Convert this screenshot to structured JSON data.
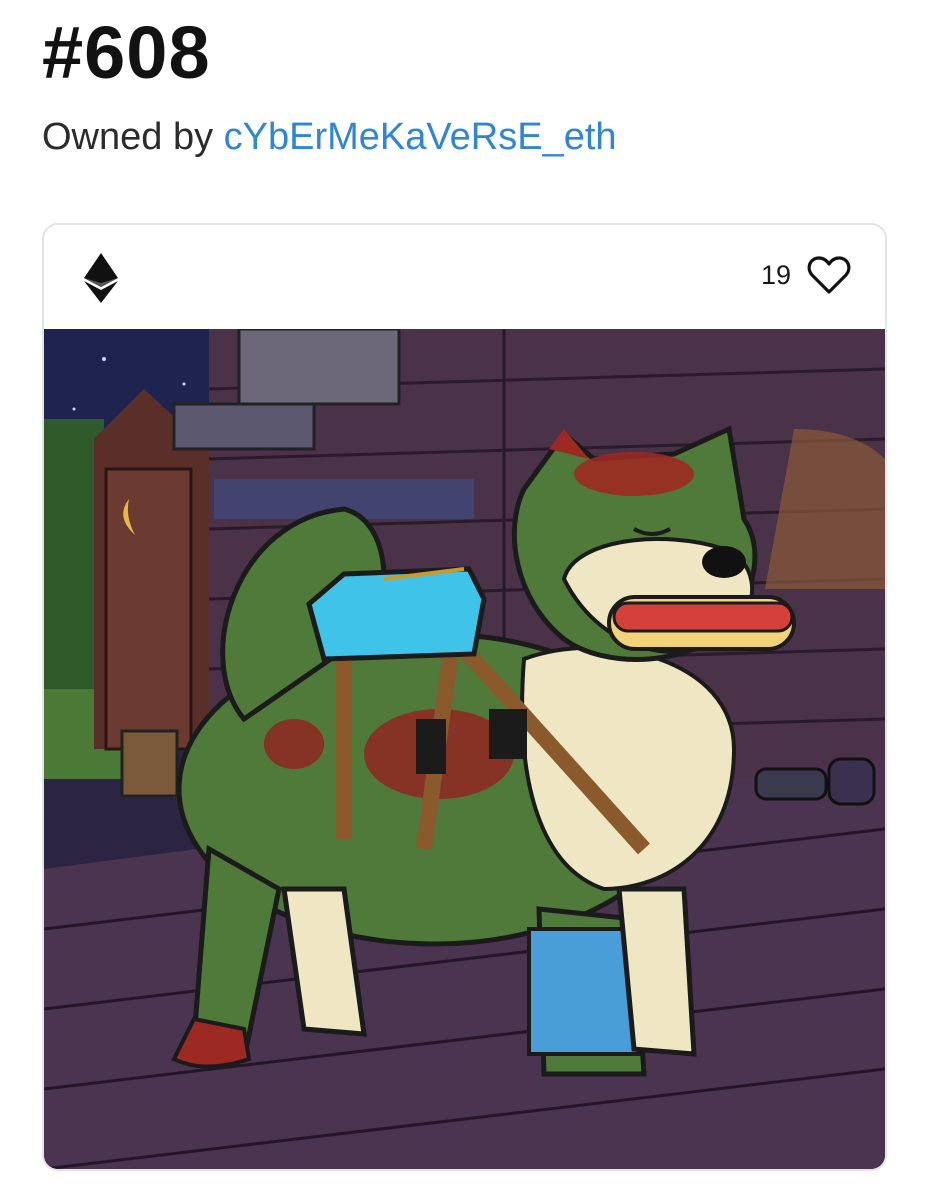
{
  "page": {
    "title": "#608",
    "owner_prefix": "Owned by",
    "owner_name": "cYbErMeKaVeRsE_eth"
  },
  "card": {
    "chain_icon": "ethereum-icon",
    "like_count": "19",
    "like_icon": "heart-outline-icon",
    "image_alt": "zombie dog with backpack holding a hot dog"
  },
  "colors": {
    "link": "#2f86d6",
    "title": "#121212",
    "card_border": "#e4e4e4"
  }
}
